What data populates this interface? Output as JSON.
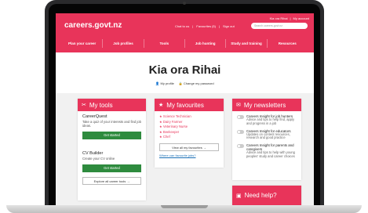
{
  "header": {
    "logo": "careers.govt.nz",
    "util_links": [
      "Kia ora Rihai",
      "|",
      "My account"
    ],
    "top_links": [
      "Chat to us",
      "|",
      "Favourites (5)",
      "|",
      "Sign out"
    ],
    "search_placeholder": "Search careers.govt.nz",
    "nav": [
      "Plan your career",
      "Job profiles",
      "Tools",
      "Job hunting",
      "Study and training",
      "Resources"
    ]
  },
  "hero": {
    "greeting": "Kia ora Rihai",
    "profile_link": "My profile",
    "password_link": "Change my password"
  },
  "tools": {
    "title": "My tools",
    "careerquest_title": "CareerQuest",
    "careerquest_text": "Take a quiz of your interests and find job ideas.",
    "get_started_1": "Get started",
    "cvbuilder_title": "CV Builder",
    "cvbuilder_text": "Create your CV online",
    "get_started_2": "Get started",
    "explore": "Explore all career tools →"
  },
  "favourites": {
    "title": "My favourites",
    "items": [
      "Science Technician",
      "Dairy Farmer",
      "Veterinary Nurse",
      "Beekeeper",
      "Chef"
    ],
    "view_all": "View all my favourites →",
    "where_link": "Where can favourite jobs?"
  },
  "newsletters": {
    "title": "My newsletters",
    "items": [
      {
        "title": "Careers Insight for job hunters",
        "desc": "Advice and tips to help find, apply and progress in a job"
      },
      {
        "title": "Careers Insight for educators",
        "desc": "Updates on content resources, research and good practice"
      },
      {
        "title": "Careers Insight for parents and caregivers",
        "desc": "Advice and tips to help with young peoples' study and career choices"
      }
    ]
  },
  "help": {
    "title": "Need help?"
  },
  "colors": {
    "brand": "#e8345a",
    "button": "#2e8b3e"
  }
}
